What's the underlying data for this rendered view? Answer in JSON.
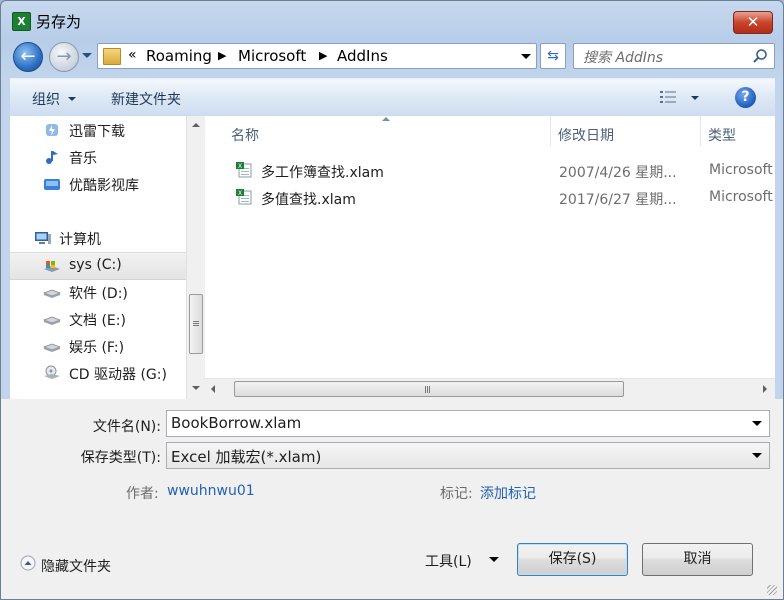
{
  "window": {
    "title": "另存为",
    "close": "✕"
  },
  "navigation": {
    "breadcrumbs": [
      "Roaming",
      "Microsoft",
      "AddIns"
    ],
    "overflow": "«",
    "search_placeholder": "搜索 AddIns"
  },
  "toolbar": {
    "organize": "组织",
    "new_folder": "新建文件夹",
    "help": "?"
  },
  "nav_pane": {
    "items": [
      {
        "label": "迅雷下载",
        "icon": "thunder-download-icon"
      },
      {
        "label": "音乐",
        "icon": "music-icon"
      },
      {
        "label": "优酷影视库",
        "icon": "youku-library-icon"
      },
      {
        "label": "计算机",
        "icon": "computer-icon"
      },
      {
        "label": "sys (C:)",
        "icon": "windows-drive-icon",
        "selected": true
      },
      {
        "label": "软件 (D:)",
        "icon": "drive-icon"
      },
      {
        "label": "文档 (E:)",
        "icon": "drive-icon"
      },
      {
        "label": "娱乐 (F:)",
        "icon": "drive-icon"
      },
      {
        "label": "CD 驱动器 (G:)",
        "icon": "cd-drive-icon"
      }
    ]
  },
  "file_list": {
    "columns": [
      "名称",
      "修改日期",
      "类型"
    ],
    "rows": [
      {
        "name": "多工作簿查找.xlam",
        "date": "2007/4/26 星期...",
        "type": "Microsoft"
      },
      {
        "name": "多值查找.xlam",
        "date": "2017/6/27 星期...",
        "type": "Microsoft"
      }
    ]
  },
  "form": {
    "filename_label": "文件名(N):",
    "filename_value": "BookBorrow.xlam",
    "filetype_label": "保存类型(T):",
    "filetype_value": "Excel 加载宏(*.xlam)",
    "author_label": "作者:",
    "author_value": "wwuhnwu01",
    "tags_label": "标记:",
    "tags_value": "添加标记"
  },
  "footer": {
    "hide_folders": "隐藏文件夹",
    "tools": "工具(L)",
    "save": "保存(S)",
    "cancel": "取消"
  }
}
